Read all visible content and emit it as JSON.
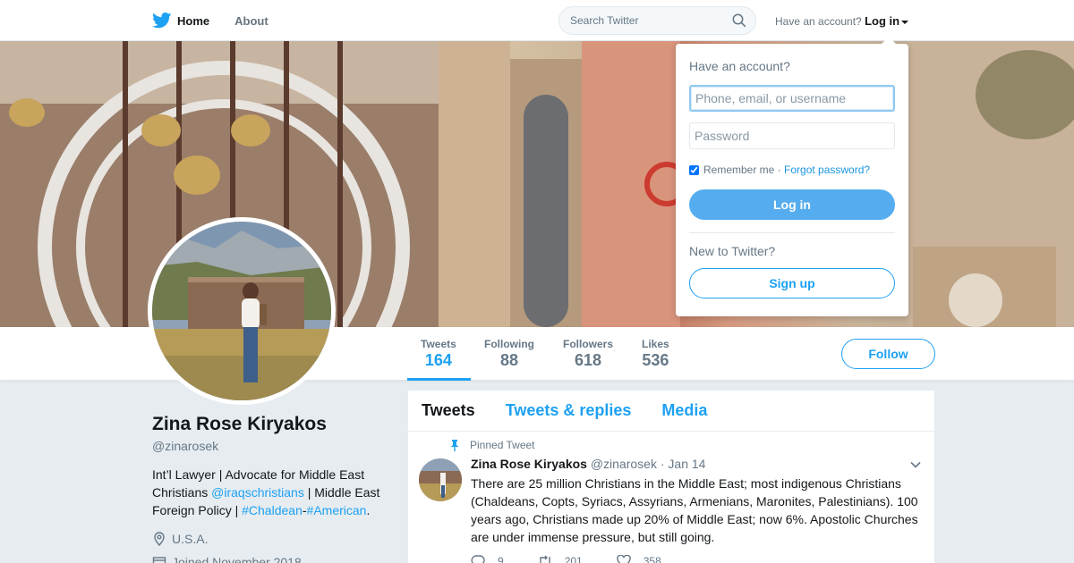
{
  "nav": {
    "home_label": "Home",
    "about_label": "About",
    "search_placeholder": "Search Twitter",
    "have_account_text": "Have an account?",
    "login_label": "Log in"
  },
  "profile": {
    "name": "Zina Rose Kiryakos",
    "handle": "@zinarosek",
    "bio_part1": "Int’l Lawyer | Advocate for Middle East Christians ",
    "bio_mention": "@iraqschristians",
    "bio_part2": " | Middle East Foreign Policy | ",
    "bio_hashtag1": "#Chaldean",
    "bio_dash": "-",
    "bio_hashtag2": "#American",
    "bio_end": ".",
    "location": "U.S.A.",
    "joined": "Joined November 2018",
    "follow_label": "Follow"
  },
  "stats": {
    "tweets_label": "Tweets",
    "tweets_value": "164",
    "following_label": "Following",
    "following_value": "88",
    "followers_label": "Followers",
    "followers_value": "618",
    "likes_label": "Likes",
    "likes_value": "536"
  },
  "timeline": {
    "tabs": [
      "Tweets",
      "Tweets & replies",
      "Media"
    ],
    "pinned_label": "Pinned Tweet",
    "tweet": {
      "name": "Zina Rose Kiryakos",
      "handle": "@zinarosek",
      "date": "· Jan 14",
      "text": "There are 25 million Christians in the Middle East; most indigenous Christians (Chaldeans, Copts, Syriacs, Assyrians, Armenians, Maronites, Palestinians). 100 years ago, Christians made up 20% of Middle East; now 6%. Apostolic Churches are under immense pressure, but still going.",
      "replies": "9",
      "retweets": "201",
      "likes": "358"
    }
  },
  "login_dropdown": {
    "title": "Have an account?",
    "username_placeholder": "Phone, email, or username",
    "password_placeholder": "Password",
    "remember_label": "Remember me",
    "separator": " · ",
    "forgot_label": "Forgot password?",
    "login_button": "Log in",
    "new_text": "New to Twitter?",
    "signup_button": "Sign up"
  },
  "colors": {
    "accent": "#1da1f2",
    "login_button": "#55acee",
    "background": "#e6ecf0"
  }
}
